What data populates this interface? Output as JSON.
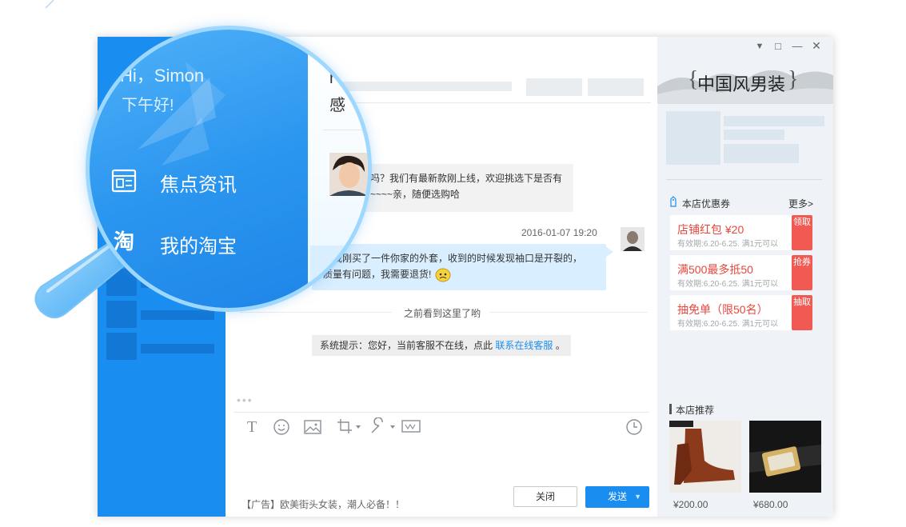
{
  "window_controls": {
    "dropdown": "▼",
    "restore": "□",
    "minimize": "—",
    "close": "✕"
  },
  "sidebar": {
    "greeting": "Hi，Simon",
    "greeting_time": "下午好!",
    "items": [
      {
        "label": "焦点资讯",
        "icon": "news-icon"
      },
      {
        "label": "我的淘宝",
        "icon": "taobao-icon"
      }
    ]
  },
  "chat": {
    "header_fragment_1": "r",
    "header_fragment_2": "感",
    "messages": [
      {
        "from": "agent",
        "text_line1": "吗？我们有最新款刚上线，欢迎挑选下是否有",
        "text_line2": "~~~~亲，随便选购哈"
      },
      {
        "from": "user",
        "timestamp": "2016-01-07  19:20",
        "text_line1": "周我刚买了一件你家的外套，收到的时候发现袖口是开裂的，",
        "text_line2": "质量有问题，我需要退货!"
      }
    ],
    "divider_text": "之前看到这里了哟",
    "system_notice": "系统提示：您好，当前客服不在线，点此",
    "system_link": "联系在线客服",
    "system_end": "。",
    "typing": "•••"
  },
  "toolbar": {
    "text_tool": "T",
    "emoji_tool": "☺",
    "image_tool": "▨",
    "crop_tool": "⌗",
    "settings_tool": "✎",
    "screen_tool": "▭",
    "history_tool": "◷",
    "ad_text": "【广告】欧美街头女装，潮人必备！！",
    "close_label": "关闭",
    "send_label": "发送",
    "send_arrow": "▼"
  },
  "shop": {
    "banner_title": "中国风男装",
    "banner_brace_left": "{",
    "banner_brace_right": "}",
    "coupons_title": "本店优惠券",
    "more_label": "更多>",
    "coupons": [
      {
        "title": "店铺红包    ¥20",
        "sub": "有效期:6.20-6.25. 满1元可以",
        "tag": "领取"
      },
      {
        "title": "满500最多抵50",
        "sub": "有效期:6.20-6.25. 满1元可以",
        "tag": "抢券"
      },
      {
        "title": "抽免单（限50名）",
        "sub": "有效期:6.20-6.25. 满1元可以",
        "tag": "抽取"
      }
    ],
    "recommend_title": "本店推荐",
    "products": [
      {
        "price": "¥200.00",
        "image": "brown-shoe"
      },
      {
        "price": "¥680.00",
        "image": "belt-buckle"
      }
    ]
  },
  "colors": {
    "accent": "#1a8ef0",
    "coupon_red": "#e8473e",
    "bubble_blue": "#d9eeff"
  }
}
